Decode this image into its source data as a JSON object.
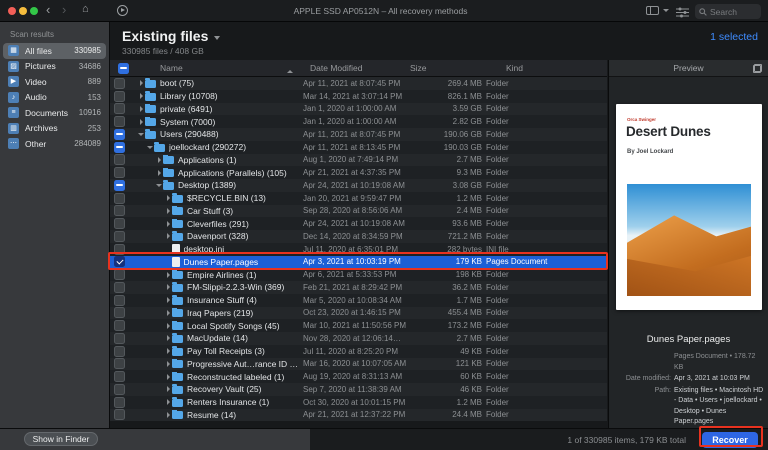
{
  "window": {
    "title": "APPLE SSD AP0512N – All recovery methods",
    "search_placeholder": "Search"
  },
  "sidebar": {
    "header": "Scan results",
    "items": [
      {
        "label": "All files",
        "count": "330985",
        "icon": "all-files-icon",
        "selected": true
      },
      {
        "label": "Pictures",
        "count": "34686",
        "icon": "pictures-icon"
      },
      {
        "label": "Video",
        "count": "889",
        "icon": "video-icon"
      },
      {
        "label": "Audio",
        "count": "153",
        "icon": "audio-icon"
      },
      {
        "label": "Documents",
        "count": "10916",
        "icon": "documents-icon"
      },
      {
        "label": "Archives",
        "count": "253",
        "icon": "archives-icon"
      },
      {
        "label": "Other",
        "count": "284089",
        "icon": "other-icon"
      }
    ],
    "show_in_finder": "Show in Finder"
  },
  "header": {
    "title": "Existing files",
    "subtitle": "330985 files / 408 GB",
    "selected_label": "1 selected"
  },
  "table": {
    "columns": [
      "Name",
      "Date Modified",
      "Size",
      "Kind"
    ],
    "rows": [
      {
        "name": "boot (75)",
        "date": "Apr 11, 2021 at 8:07:45 PM",
        "size": "269.4 MB",
        "kind": "Folder",
        "depth": 0,
        "type": "folder",
        "expanded": false,
        "checkbox": "unchecked"
      },
      {
        "name": "Library (10708)",
        "date": "Mar 14, 2021 at 3:07:14 PM",
        "size": "826.1 MB",
        "kind": "Folder",
        "depth": 0,
        "type": "folder",
        "expanded": false,
        "checkbox": "unchecked"
      },
      {
        "name": "private (6491)",
        "date": "Jan 1, 2020 at 1:00:00 AM",
        "size": "3.59 GB",
        "kind": "Folder",
        "depth": 0,
        "type": "folder",
        "expanded": false,
        "checkbox": "unchecked"
      },
      {
        "name": "System (7000)",
        "date": "Jan 1, 2020 at 1:00:00 AM",
        "size": "2.82 GB",
        "kind": "Folder",
        "depth": 0,
        "type": "folder",
        "expanded": false,
        "checkbox": "unchecked"
      },
      {
        "name": "Users (290488)",
        "date": "Apr 11, 2021 at 8:07:45 PM",
        "size": "190.06 GB",
        "kind": "Folder",
        "depth": 0,
        "type": "folder",
        "expanded": true,
        "checkbox": "mixed"
      },
      {
        "name": "joellockard (290272)",
        "date": "Apr 11, 2021 at 8:13:45 PM",
        "size": "190.03 GB",
        "kind": "Folder",
        "depth": 1,
        "type": "folder",
        "expanded": true,
        "checkbox": "mixed"
      },
      {
        "name": "Applications (1)",
        "date": "Aug 1, 2020 at 7:49:14 PM",
        "size": "2.7 MB",
        "kind": "Folder",
        "depth": 2,
        "type": "folder",
        "expanded": false,
        "checkbox": "unchecked"
      },
      {
        "name": "Applications (Parallels) (105)",
        "date": "Apr 21, 2021 at 4:37:35 PM",
        "size": "9.3 MB",
        "kind": "Folder",
        "depth": 2,
        "type": "folder",
        "expanded": false,
        "checkbox": "unchecked"
      },
      {
        "name": "Desktop (1389)",
        "date": "Apr 24, 2021 at 10:19:08 AM",
        "size": "3.08 GB",
        "kind": "Folder",
        "depth": 2,
        "type": "folder",
        "expanded": true,
        "checkbox": "mixed"
      },
      {
        "name": "$RECYCLE.BIN (13)",
        "date": "Jan 20, 2021 at 9:59:47 PM",
        "size": "1.2 MB",
        "kind": "Folder",
        "depth": 3,
        "type": "folder",
        "expanded": false,
        "checkbox": "unchecked"
      },
      {
        "name": "Car Stuff (3)",
        "date": "Sep 28, 2020 at 8:56:06 AM",
        "size": "2.4 MB",
        "kind": "Folder",
        "depth": 3,
        "type": "folder",
        "expanded": false,
        "checkbox": "unchecked"
      },
      {
        "name": "Cleverfiles (291)",
        "date": "Apr 24, 2021 at 10:19:08 AM",
        "size": "93.6 MB",
        "kind": "Folder",
        "depth": 3,
        "type": "folder",
        "expanded": false,
        "checkbox": "unchecked"
      },
      {
        "name": "Davenport (328)",
        "date": "Dec 14, 2020 at 8:34:59 PM",
        "size": "721.2 MB",
        "kind": "Folder",
        "depth": 3,
        "type": "folder",
        "expanded": false,
        "checkbox": "unchecked"
      },
      {
        "name": "desktop.ini",
        "date": "Jul 11, 2020 at 6:35:01 PM",
        "size": "282 bytes",
        "kind": "INI file",
        "depth": 3,
        "type": "file",
        "expanded": false,
        "checkbox": "unchecked"
      },
      {
        "name": "Dunes Paper.pages",
        "date": "Apr 3, 2021 at 10:03:19 PM",
        "size": "179 KB",
        "kind": "Pages Document",
        "depth": 3,
        "type": "file",
        "expanded": false,
        "checkbox": "checked",
        "selected": true
      },
      {
        "name": "Empire Airlines (1)",
        "date": "Apr 6, 2021 at 5:33:53 PM",
        "size": "198 KB",
        "kind": "Folder",
        "depth": 3,
        "type": "folder",
        "expanded": false,
        "checkbox": "unchecked"
      },
      {
        "name": "FM-Slippi-2.2.3-Win (369)",
        "date": "Feb 21, 2021 at 8:29:42 PM",
        "size": "36.2 MB",
        "kind": "Folder",
        "depth": 3,
        "type": "folder",
        "expanded": false,
        "checkbox": "unchecked"
      },
      {
        "name": "Insurance Stuff (4)",
        "date": "Mar 5, 2020 at 10:08:34 AM",
        "size": "1.7 MB",
        "kind": "Folder",
        "depth": 3,
        "type": "folder",
        "expanded": false,
        "checkbox": "unchecked"
      },
      {
        "name": "Iraq Papers (219)",
        "date": "Oct 23, 2020 at 1:46:15 PM",
        "size": "455.4 MB",
        "kind": "Folder",
        "depth": 3,
        "type": "folder",
        "expanded": false,
        "checkbox": "unchecked"
      },
      {
        "name": "Local Spotify Songs (45)",
        "date": "Mar 10, 2021 at 11:50:56 PM",
        "size": "173.2 MB",
        "kind": "Folder",
        "depth": 3,
        "type": "folder",
        "expanded": false,
        "checkbox": "unchecked"
      },
      {
        "name": "MacUpdate (14)",
        "date": "Nov 28, 2020 at 12:06:14…",
        "size": "2.7 MB",
        "kind": "Folder",
        "depth": 3,
        "type": "folder",
        "expanded": false,
        "checkbox": "unchecked"
      },
      {
        "name": "Pay Toll Receipts (3)",
        "date": "Jul 11, 2020 at 8:25:20 PM",
        "size": "49 KB",
        "kind": "Folder",
        "depth": 3,
        "type": "folder",
        "expanded": false,
        "checkbox": "unchecked"
      },
      {
        "name": "Progressive Aut…rance ID Cards (1)",
        "date": "Mar 16, 2020 at 10:07:05 AM",
        "size": "121 KB",
        "kind": "Folder",
        "depth": 3,
        "type": "folder",
        "expanded": false,
        "checkbox": "unchecked"
      },
      {
        "name": "Reconstructed labeled (1)",
        "date": "Aug 19, 2020 at 8:31:13 AM",
        "size": "60 KB",
        "kind": "Folder",
        "depth": 3,
        "type": "folder",
        "expanded": false,
        "checkbox": "unchecked"
      },
      {
        "name": "Recovery Vault (25)",
        "date": "Sep 7, 2020 at 11:38:39 AM",
        "size": "46 KB",
        "kind": "Folder",
        "depth": 3,
        "type": "folder",
        "expanded": false,
        "checkbox": "unchecked"
      },
      {
        "name": "Renters Insurance (1)",
        "date": "Oct 30, 2020 at 10:01:15 PM",
        "size": "1.2 MB",
        "kind": "Folder",
        "depth": 3,
        "type": "folder",
        "expanded": false,
        "checkbox": "unchecked"
      },
      {
        "name": "Resume (14)",
        "date": "Apr 21, 2021 at 12:37:22 PM",
        "size": "24.4 MB",
        "kind": "Folder",
        "depth": 3,
        "type": "folder",
        "expanded": false,
        "checkbox": "unchecked"
      }
    ]
  },
  "preview": {
    "panel_title": "Preview",
    "doc_category": "Orca Swinger",
    "doc_title": "Desert Dunes",
    "doc_byline": "By Joel Lockard",
    "file_name": "Dunes Paper.pages",
    "file_meta": "Pages Document • 178.72 KB",
    "date_modified_label": "Date modified:",
    "date_modified": "Apr 3, 2021 at 10:03 PM",
    "path_label": "Path:",
    "path_value": "Existing files • Macintosh HD - Data • Users • joellockard • Desktop • Dunes Paper.pages"
  },
  "statusbar": {
    "summary": "1 of 330985 items, 179 KB total",
    "recover_label": "Recover"
  },
  "colors": {
    "accent_blue": "#2e66e4",
    "selection_blue": "#1c5fd6",
    "link_blue": "#3f8cff",
    "annotation_red": "#e8321f",
    "folder_blue": "#54a7e8",
    "sidebar_selection": "#5d6165"
  },
  "icon_glyphs": {
    "all-files-icon": "▦",
    "pictures-icon": "▨",
    "video-icon": "▶",
    "audio-icon": "♪",
    "documents-icon": "≡",
    "archives-icon": "▥",
    "other-icon": "⋯"
  }
}
